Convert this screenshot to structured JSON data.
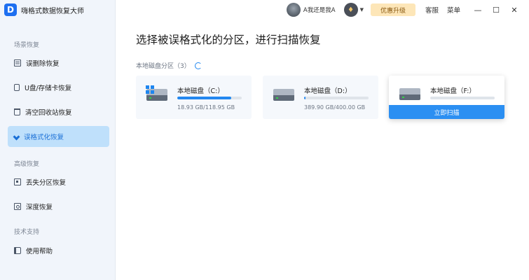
{
  "app": {
    "logo_letter": "D",
    "title": "嗨格式数据恢复大师"
  },
  "sidebar": {
    "sections": [
      {
        "title": "场景恢复",
        "items": [
          {
            "label": "误删除恢复",
            "icon": "document-icon"
          },
          {
            "label": "U盘/存储卡恢复",
            "icon": "usb-drive-icon"
          },
          {
            "label": "清空回收站恢复",
            "icon": "trash-icon"
          },
          {
            "label": "误格式化恢复",
            "icon": "brush-icon",
            "active": true
          }
        ]
      },
      {
        "title": "高级恢复",
        "items": [
          {
            "label": "丢失分区恢复",
            "icon": "partition-icon"
          },
          {
            "label": "深度恢复",
            "icon": "deep-scan-icon"
          }
        ]
      },
      {
        "title": "技术支持",
        "items": [
          {
            "label": "使用帮助",
            "icon": "help-book-icon"
          }
        ]
      }
    ]
  },
  "topbar": {
    "username": "A我还是我A",
    "upgrade_label": "优惠升级",
    "service_label": "客服",
    "menu_label": "菜单",
    "minimize_glyph": "—",
    "maximize_glyph": "☐",
    "close_glyph": "✕"
  },
  "main": {
    "title": "选择被误格式化的分区，进行扫描恢复",
    "section_label": "本地磁盘分区（3）",
    "disks": [
      {
        "name": "本地磁盘（C:）",
        "size": "18.93 GB/118.95 GB",
        "usage": 0.84,
        "system": true
      },
      {
        "name": "本地磁盘（D:）",
        "size": "389.90 GB/400.00 GB",
        "usage": 0.02
      },
      {
        "name": "本地磁盘（F:）",
        "size": "",
        "usage": 0,
        "hovered": true,
        "scan_label": "立即扫描"
      }
    ]
  },
  "colors": {
    "accent": "#2b8ff2",
    "active_nav_bg": "#bfe0fb",
    "upgrade_bg": "#fde6b8"
  }
}
